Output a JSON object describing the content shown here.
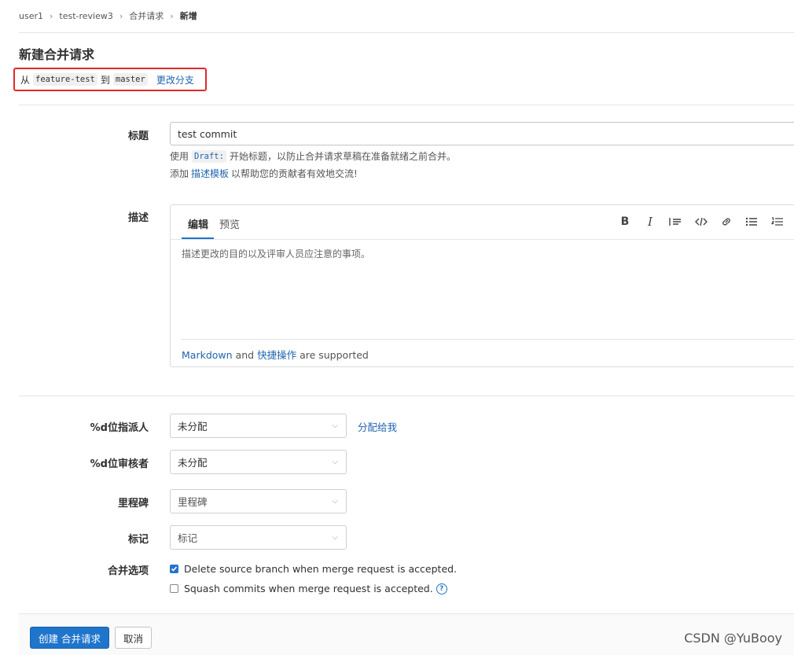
{
  "breadcrumb": [
    "user1",
    "test-review3",
    "合并请求",
    "新增"
  ],
  "page_title": "新建合并请求",
  "branch": {
    "from_prefix": "从",
    "source": "feature-test",
    "to_word": "到",
    "target": "master",
    "change_link": "更改分支"
  },
  "title_field": {
    "label": "标题",
    "value": "test commit",
    "help_prefix": "使用",
    "help_code": "Draft:",
    "help_suffix": "开始标题，以防止合并请求草稿在准备就绪之前合并。",
    "template_prefix": "添加",
    "template_link": "描述模板",
    "template_suffix": "以帮助您的贡献者有效地交流!"
  },
  "description": {
    "label": "描述",
    "tab_edit": "编辑",
    "tab_preview": "预览",
    "placeholder": "描述更改的目的以及评审人员应注意的事项。",
    "footer_link1": "Markdown",
    "footer_and": "and",
    "footer_link2": "快捷操作",
    "footer_suffix": "are supported",
    "toolbar": [
      "bold-icon",
      "italic-icon",
      "quote-icon",
      "code-icon",
      "link-icon",
      "bullet-list-icon",
      "numbered-list-icon"
    ]
  },
  "assignee": {
    "label": "%d位指派人",
    "value": "未分配",
    "assign_me": "分配给我"
  },
  "reviewer": {
    "label": "%d位审核者",
    "value": "未分配"
  },
  "milestone": {
    "label": "里程碑",
    "value": "里程碑"
  },
  "labels": {
    "label": "标记",
    "value": "标记"
  },
  "merge_options": {
    "label": "合并选项",
    "delete_branch": "Delete source branch when merge request is accepted.",
    "delete_branch_checked": true,
    "squash": "Squash commits when merge request is accepted.",
    "squash_checked": false,
    "help_glyph": "?"
  },
  "actions": {
    "submit": "创建 合并请求",
    "cancel": "取消"
  },
  "watermark": "CSDN @YuBooy",
  "colors": {
    "primary": "#1f75cb",
    "link": "#1f64b0",
    "highlight_box": "#e0292b"
  }
}
